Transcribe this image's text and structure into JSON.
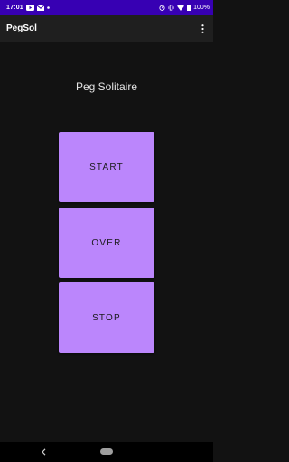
{
  "status_bar": {
    "time": "17:01",
    "battery_text": "100%",
    "background_color": "#3700b3",
    "left_icons": [
      "youtube-icon",
      "mail-icon",
      "dot-icon"
    ],
    "right_icons": [
      "alarm-icon",
      "vibrate-icon",
      "wifi-icon",
      "battery-icon"
    ]
  },
  "app_bar": {
    "title": "PegSol",
    "menu_icon": "more-vert-icon"
  },
  "main": {
    "heading": "Peg Solitaire",
    "accent_color": "#bb86fc",
    "buttons": {
      "start": "START",
      "over": "OVER",
      "stop": "STOP"
    }
  },
  "nav_bar": {
    "back_icon": "chevron-left-icon",
    "home_icon": "home-pill-icon"
  }
}
